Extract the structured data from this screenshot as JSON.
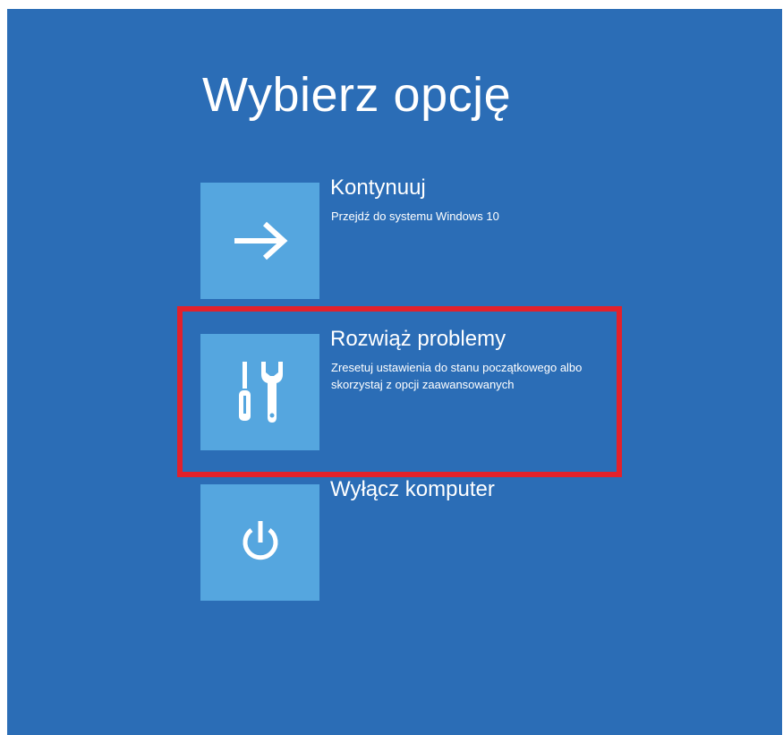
{
  "title": "Wybierz opcję",
  "options": [
    {
      "label": "Kontynuuj",
      "description": "Przejdź do systemu Windows 10",
      "icon": "arrow-right-icon"
    },
    {
      "label": "Rozwiąż problemy",
      "description": "Zresetuj ustawienia do stanu początkowego albo skorzystaj z opcji zaawansowanych",
      "icon": "tools-icon"
    },
    {
      "label": "Wyłącz komputer",
      "description": "",
      "icon": "power-icon"
    }
  ],
  "colors": {
    "background": "#2b6db6",
    "tile": "#55a6df",
    "highlight": "#e3212b",
    "text": "#ffffff"
  }
}
